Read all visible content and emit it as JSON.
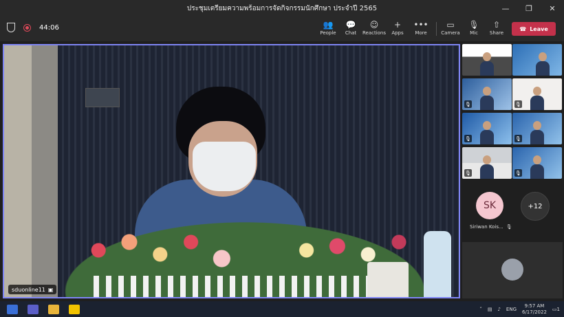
{
  "window": {
    "title": "ประชุมเตรียมความพร้อมการจัดกิจกรรมนักศึกษา ประจำปี 2565",
    "minimize": "—",
    "maximize": "❐",
    "close": "✕"
  },
  "toolbar": {
    "timer": "44:06",
    "buttons": [
      {
        "label": "People",
        "icon": "people-icon",
        "glyph": "👥"
      },
      {
        "label": "Chat",
        "icon": "chat-icon",
        "glyph": "💬"
      },
      {
        "label": "Reactions",
        "icon": "reactions-icon",
        "glyph": "☺"
      },
      {
        "label": "Apps",
        "icon": "apps-icon",
        "glyph": "+"
      },
      {
        "label": "More",
        "icon": "more-icon",
        "glyph": "•••"
      },
      {
        "label": "Camera",
        "icon": "camera-icon",
        "glyph": "▭"
      },
      {
        "label": "Mic",
        "icon": "mic-icon",
        "glyph": "🎙"
      },
      {
        "label": "Share",
        "icon": "share-icon",
        "glyph": "⇧"
      }
    ],
    "leave_label": "Leave",
    "leave_color": "#c4314b"
  },
  "main_video": {
    "participant_name": "sduonline11"
  },
  "side_panel": {
    "attendee_initials": "SK",
    "attendee_name": "Siriwan Kois...",
    "overflow_count": "+12"
  },
  "taskbar": {
    "language": "ENG",
    "time": "9:57 AM",
    "date": "6/17/2022",
    "notification_count": "1"
  },
  "colors": {
    "accent": "#7f85f5",
    "leave": "#c4314b"
  }
}
